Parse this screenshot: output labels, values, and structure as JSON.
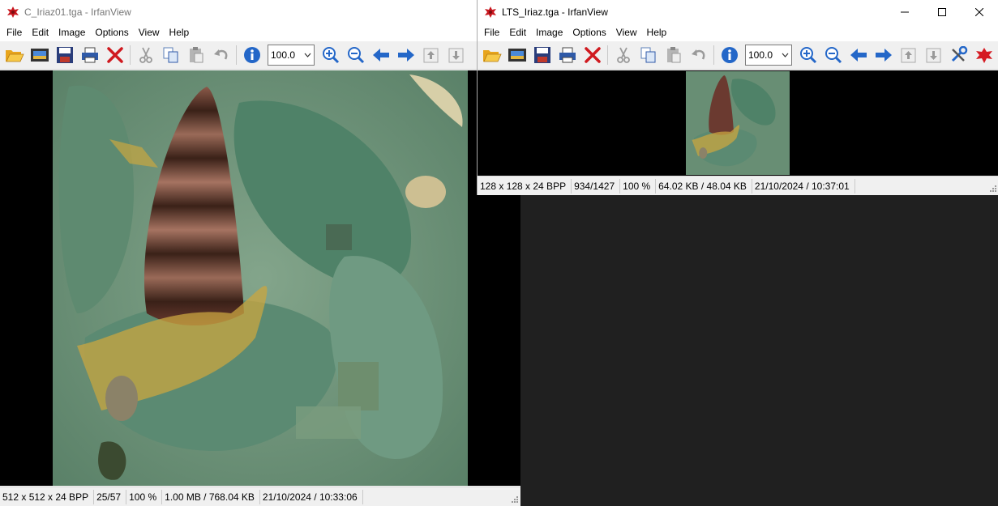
{
  "windows": [
    {
      "title": "C_Iriaz01.tga - IrfanView",
      "menu": [
        "File",
        "Edit",
        "Image",
        "Options",
        "View",
        "Help"
      ],
      "zoom": "100.0",
      "status": [
        "512 x 512 x 24 BPP",
        "25/57",
        "100 %",
        "1.00 MB / 768.04 KB",
        "21/10/2024 / 10:33:06"
      ]
    },
    {
      "title": "LTS_Iriaz.tga - IrfanView",
      "menu": [
        "File",
        "Edit",
        "Image",
        "Options",
        "View",
        "Help"
      ],
      "zoom": "100.0",
      "status": [
        "128 x 128 x 24 BPP",
        "934/1427",
        "100 %",
        "64.02 KB / 48.04 KB",
        "21/10/2024 / 10:37:01"
      ]
    }
  ],
  "toolbar_icons": [
    "open-folder-icon",
    "slideshow-icon",
    "save-icon",
    "print-icon",
    "delete-icon",
    "cut-icon",
    "copy-icon",
    "paste-icon",
    "undo-icon",
    "info-icon",
    "zoom-in-icon",
    "zoom-out-icon",
    "prev-arrow-icon",
    "next-arrow-icon",
    "page-up-icon",
    "page-down-icon",
    "settings-icon",
    "irfanview-logo-icon"
  ],
  "colors": {
    "canvas_bg": "#000000",
    "desktop_bg": "#202020",
    "texture_green": "#6f9a82",
    "texture_gold": "#c9a640",
    "texture_brown": "#6b3a30"
  }
}
